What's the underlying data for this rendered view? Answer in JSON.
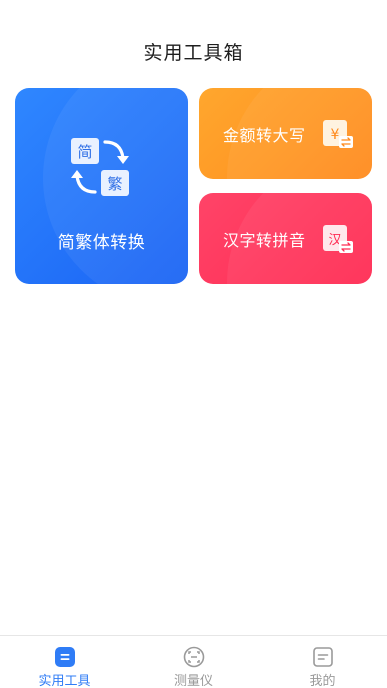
{
  "header": {
    "title": "实用工具箱"
  },
  "tools": {
    "convert": {
      "label": "简繁体转换",
      "icon_simplified": "简",
      "icon_traditional": "繁"
    },
    "money": {
      "label": "金额转大写",
      "icon_glyph": "¥"
    },
    "pinyin": {
      "label": "汉字转拼音",
      "icon_glyph": "汉"
    }
  },
  "tabbar": {
    "items": [
      {
        "label": "实用工具",
        "icon": "toolbox-icon",
        "active": true
      },
      {
        "label": "测量仪",
        "icon": "measure-icon",
        "active": false
      },
      {
        "label": "我的",
        "icon": "profile-icon",
        "active": false
      }
    ]
  },
  "colors": {
    "blue": "#1a63f4",
    "orange": "#ff8a1c",
    "red": "#ff2a52",
    "tab_active": "#2f7cf6",
    "tab_inactive": "#9a9a9a"
  }
}
